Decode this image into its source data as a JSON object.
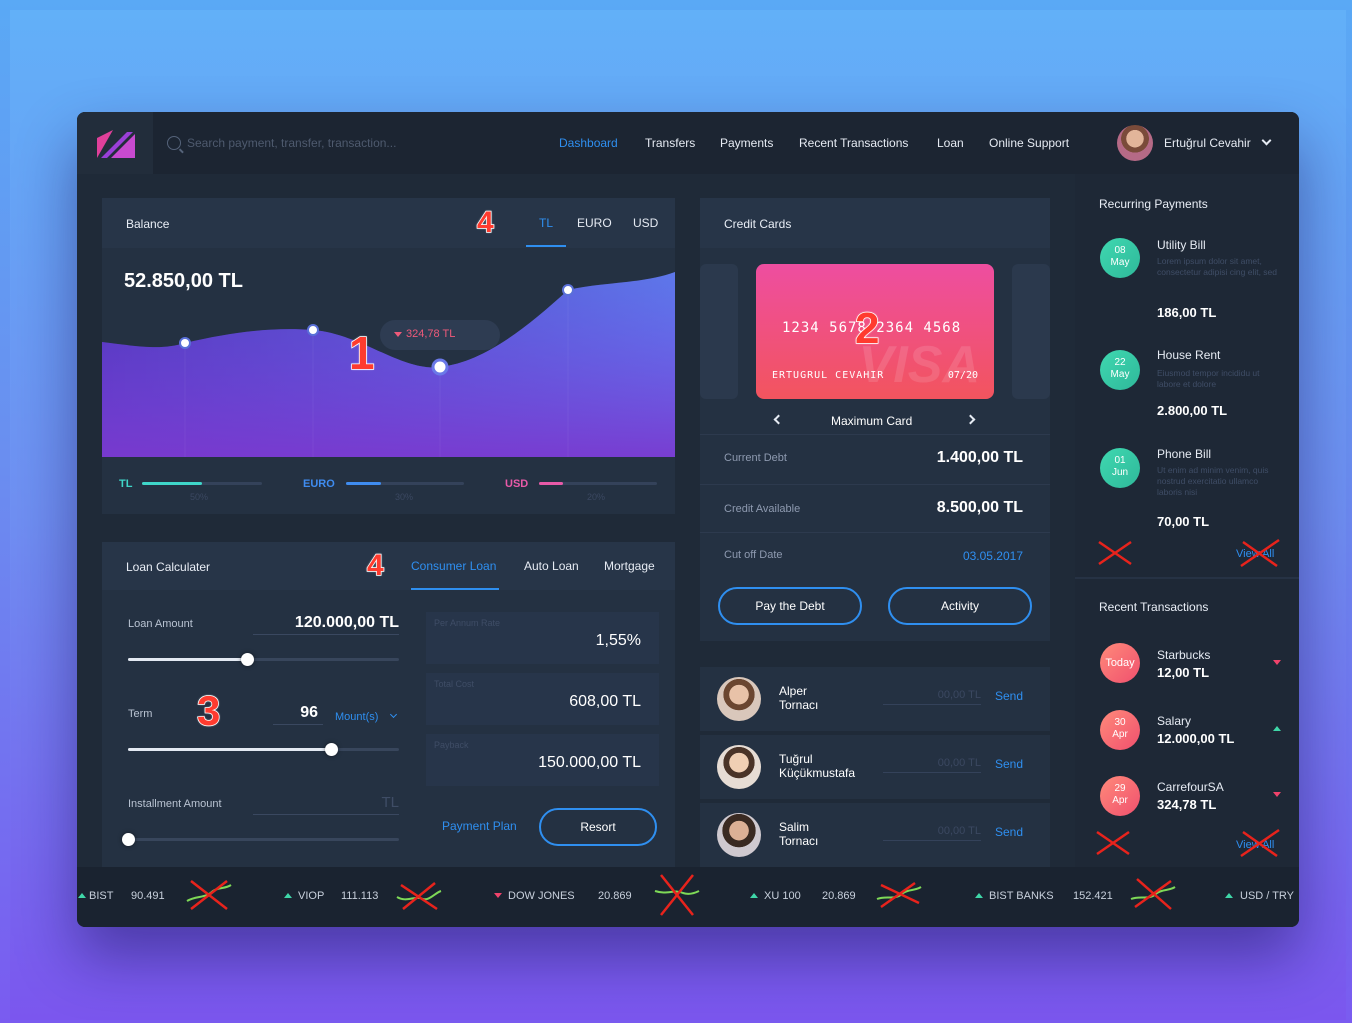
{
  "search": {
    "placeholder": "Search payment, transfer, transaction..."
  },
  "nav": {
    "items": [
      {
        "label": "Dashboard",
        "active": true
      },
      {
        "label": "Transfers"
      },
      {
        "label": "Payments"
      },
      {
        "label": "Recent Transactions"
      },
      {
        "label": "Loan"
      },
      {
        "label": "Online Support"
      }
    ],
    "user_name": "Ertuğrul Cevahir"
  },
  "balance": {
    "title": "Balance",
    "tabs": [
      "TL",
      "EURO",
      "USD"
    ],
    "active_tab": "TL",
    "amount": "52.850,00 TL",
    "tooltip": "324,78 TL",
    "currencies": [
      {
        "label": "TL",
        "color": "#3fd6c9",
        "fraction": 0.5,
        "pct": "50%"
      },
      {
        "label": "EURO",
        "color": "#3f8cf0",
        "fraction": 0.3,
        "pct": "30%"
      },
      {
        "label": "USD",
        "color": "#e85aa8",
        "fraction": 0.2,
        "pct": "20%"
      }
    ]
  },
  "loan": {
    "title": "Loan Calculater",
    "tabs": [
      "Consumer Loan",
      "Auto Loan",
      "Mortgage"
    ],
    "active_tab": "Consumer Loan",
    "amount_label": "Loan Amount",
    "amount_value": "120.000,00 TL",
    "amount_slider": 0.44,
    "term_label": "Term",
    "term_value": "96",
    "term_unit": "Mount(s)",
    "term_slider": 0.75,
    "installment_label": "Installment Amount",
    "installment_placeholder": "TL",
    "installment_slider": 0.0,
    "rate_label": "Per Annum Rate",
    "rate_value": "1,55%",
    "cost_label": "Total Cost",
    "cost_value": "608,00 TL",
    "payback_label": "Payback",
    "payback_value": "150.000,00 TL",
    "payment_plan": "Payment Plan",
    "resort": "Resort"
  },
  "credit": {
    "title": "Credit Cards",
    "card_number": "1234 5678 2364 4568",
    "card_holder": "ERTUGRUL CEVAHIR",
    "card_exp": "07/20",
    "card_brand": "VISA",
    "card_name": "Maximum Card",
    "debt_label": "Current Debt",
    "debt_value": "1.400,00 TL",
    "avail_label": "Credit Available",
    "avail_value": "8.500,00 TL",
    "cutoff_label": "Cut off Date",
    "cutoff_value": "03.05.2017",
    "pay_btn": "Pay the Debt",
    "activity_btn": "Activity"
  },
  "contacts": [
    {
      "first": "Alper",
      "last": "Tornacı",
      "placeholder": "00,00 TL",
      "send": "Send"
    },
    {
      "first": "Tuğrul",
      "last": "Küçükmustafa",
      "placeholder": "00,00 TL",
      "send": "Send"
    },
    {
      "first": "Salim",
      "last": "Tornacı",
      "placeholder": "00,00 TL",
      "send": "Send"
    }
  ],
  "recurring": {
    "title": "Recurring Payments",
    "items": [
      {
        "day": "08",
        "month": "May",
        "name": "Utility Bill",
        "desc": "Lorem ipsum dolor sit amet, consectetur adipisi cing elit, sed",
        "amount": "186,00 TL"
      },
      {
        "day": "22",
        "month": "May",
        "name": "House Rent",
        "desc": "Eiusmod tempor incididu ut labore et dolore",
        "amount": "2.800,00 TL"
      },
      {
        "day": "01",
        "month": "Jun",
        "name": "Phone Bill",
        "desc": "Ut enim ad minim venim, quis nostrud exercitatio ullamco laboris nisi",
        "amount": "70,00 TL"
      }
    ],
    "view_all": "View All"
  },
  "recent": {
    "title": "Recent Transactions",
    "items": [
      {
        "date": "Today",
        "name": "Starbucks",
        "amount": "12,00 TL",
        "dir": "down"
      },
      {
        "date": "30\nApr",
        "day": "30",
        "month": "Apr",
        "name": "Salary",
        "amount": "12.000,00 TL",
        "dir": "up"
      },
      {
        "day": "29",
        "month": "Apr",
        "name": "CarrefourSA",
        "amount": "324,78 TL",
        "dir": "down"
      }
    ],
    "view_all": "View All"
  },
  "ticker": [
    {
      "name": "BIST",
      "value": "90.491",
      "dir": "up"
    },
    {
      "name": "VIOP",
      "value": "111.113",
      "dir": "up"
    },
    {
      "name": "DOW JONES",
      "value": "20.869",
      "dir": "down"
    },
    {
      "name": "XU 100",
      "value": "20.869",
      "dir": "up"
    },
    {
      "name": "BIST BANKS",
      "value": "152.421",
      "dir": "up"
    },
    {
      "name": "USD / TRY",
      "value": "",
      "dir": "up"
    }
  ],
  "annotations": [
    "1",
    "2",
    "3",
    "4",
    "4"
  ],
  "colors": {
    "accent": "#2f8ff0",
    "positive": "#3fd6a8",
    "negative": "#f0436b",
    "bg": "#1f2a38"
  }
}
